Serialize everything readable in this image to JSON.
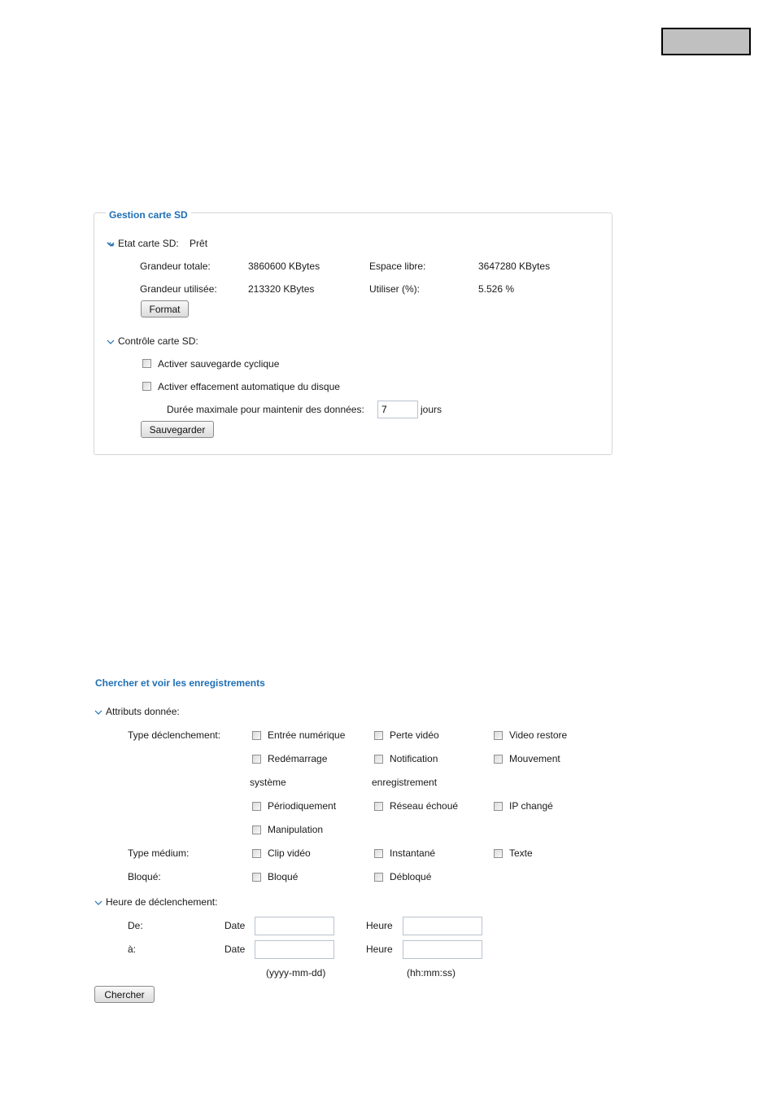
{
  "sd_panel": {
    "legend": "Gestion carte SD",
    "status": {
      "label": "Etat carte SD:",
      "value": "Prêt"
    },
    "stats": {
      "total_label": "Grandeur totale:",
      "total_value": "3860600  KBytes",
      "used_label": "Grandeur utilisée:",
      "used_value": "213320  KBytes",
      "free_label": "Espace libre:",
      "free_value": "3647280  KBytes",
      "usage_label": "Utiliser (%):",
      "usage_value": "5.526 %"
    },
    "format_button": "Format",
    "control_label": "Contrôle carte SD:",
    "cyclic_label": "Activer sauvegarde cyclique",
    "cyclic_checked": false,
    "autodelete_label": "Activer effacement automatique du disque",
    "autodelete_checked": false,
    "max_duration_label": "Durée maximale pour maintenir des données:",
    "max_duration_value": "7",
    "days_unit": "jours",
    "save_button": "Sauvegarder"
  },
  "search": {
    "title": "Chercher et voir les enregistrements",
    "attributes_label": "Attributs donnée:",
    "trigger_type_label": "Type déclenchement:",
    "triggers": {
      "digital_input": "Entrée numérique",
      "video_loss": "Perte vidéo",
      "video_restore": "Video restore",
      "reboot": "Redémarrage",
      "reboot_cont": "système",
      "notification": "Notification",
      "notification_cont": "enregistrement",
      "motion": "Mouvement",
      "periodic": "Périodiquement",
      "network_fail": "Réseau échoué",
      "ip_changed": "IP changé",
      "tampering": "Manipulation"
    },
    "media_type_label": "Type médium:",
    "media": {
      "clip": "Clip vidéo",
      "snapshot": "Instantané",
      "text": "Texte"
    },
    "locked_label": "Bloqué:",
    "locked": {
      "locked": "Bloqué",
      "unlocked": "Débloqué"
    },
    "trigger_time_label": "Heure de déclenchement:",
    "from_label": "De:",
    "to_label": "à:",
    "date_label": "Date",
    "time_label": "Heure",
    "from_date": "",
    "from_time": "",
    "to_date": "",
    "to_time": "",
    "date_format": "(yyyy-mm-dd)",
    "time_format": "(hh:mm:ss)",
    "search_button": "Chercher"
  }
}
